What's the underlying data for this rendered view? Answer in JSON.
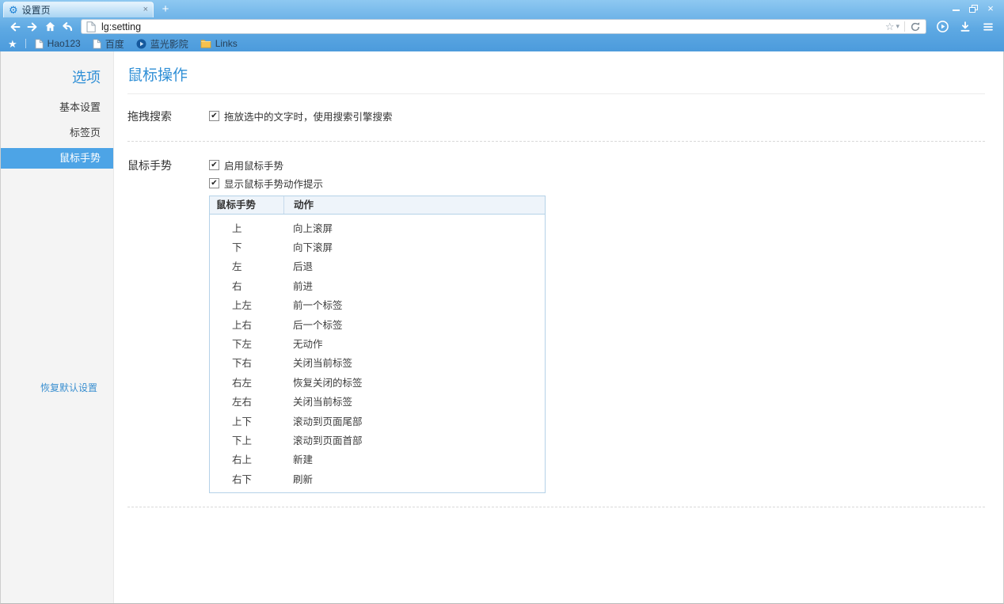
{
  "window": {
    "title_bar": {
      "tab_title": "设置页",
      "new_tab_glyph": "+"
    },
    "toolbar": {
      "address_value": "lg:setting"
    },
    "bookmarks_bar": {
      "items": [
        {
          "label": "Hao123",
          "icon": "page"
        },
        {
          "label": "百度",
          "icon": "page"
        },
        {
          "label": "蓝光影院",
          "icon": "bluray-disc"
        },
        {
          "label": "Links",
          "icon": "folder"
        }
      ]
    }
  },
  "sidebar": {
    "title": "选项",
    "items": [
      {
        "label": "基本设置",
        "active": false
      },
      {
        "label": "标签页",
        "active": false
      },
      {
        "label": "鼠标手势",
        "active": true
      }
    ],
    "reset_link": "恢复默认设置"
  },
  "main": {
    "title": "鼠标操作",
    "sections": [
      {
        "label": "拖拽搜索",
        "checkboxes": [
          {
            "label": "拖放选中的文字时，使用搜索引擎搜索",
            "checked": true
          }
        ]
      },
      {
        "label": "鼠标手势",
        "checkboxes": [
          {
            "label": "启用鼠标手势",
            "checked": true
          },
          {
            "label": "显示鼠标手势动作提示",
            "checked": true
          }
        ]
      }
    ],
    "gesture_table": {
      "headers": [
        "鼠标手势",
        "动作"
      ],
      "rows": [
        [
          "上",
          "向上滚屏"
        ],
        [
          "下",
          "向下滚屏"
        ],
        [
          "左",
          "后退"
        ],
        [
          "右",
          "前进"
        ],
        [
          "上左",
          "前一个标签"
        ],
        [
          "上右",
          "后一个标签"
        ],
        [
          "下左",
          "无动作"
        ],
        [
          "下右",
          "关闭当前标签"
        ],
        [
          "右左",
          "恢复关闭的标签"
        ],
        [
          "左右",
          "关闭当前标签"
        ],
        [
          "上下",
          "滚动到页面尾部"
        ],
        [
          "下上",
          "滚动到页面首部"
        ],
        [
          "右上",
          "新建"
        ],
        [
          "右下",
          "刷新"
        ]
      ]
    }
  },
  "glyphs": {
    "check": "✔",
    "gear": "⚙",
    "close": "×",
    "star_filled": "★",
    "star_outline": "☆",
    "caret_down": "▾"
  },
  "colors": {
    "accent": "#2f8fd6",
    "chrome_top": "#8ec8f1",
    "chrome_bottom": "#4c9bdc",
    "active_nav_bg": "#4da4e6",
    "table_border": "#b5d2e8",
    "table_header_bg": "#eef4fa"
  }
}
